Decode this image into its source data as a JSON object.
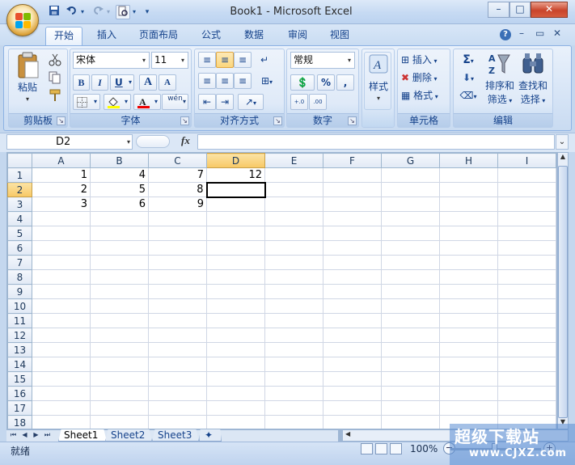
{
  "app": {
    "title": "Book1 - Microsoft Excel",
    "window_buttons": {
      "minimize": "–",
      "maximize": "□",
      "close": "✕"
    }
  },
  "qat": {
    "save_icon": "save-icon",
    "undo_icon": "undo-icon",
    "redo_icon": "redo-icon",
    "print_preview_icon": "print-preview-icon",
    "customize": "▾"
  },
  "ribbon_tabs": [
    {
      "label": "开始",
      "active": true
    },
    {
      "label": "插入"
    },
    {
      "label": "页面布局"
    },
    {
      "label": "公式"
    },
    {
      "label": "数据"
    },
    {
      "label": "审阅"
    },
    {
      "label": "视图"
    }
  ],
  "ribbon_right": {
    "help": "?",
    "minimize": "–",
    "restore": "▭",
    "close": "✕"
  },
  "groups": {
    "clipboard": {
      "label": "剪贴板",
      "paste": "粘贴"
    },
    "font": {
      "label": "字体",
      "font_name": "宋体",
      "font_size": "11",
      "bold": "B",
      "italic": "I",
      "underline": "U",
      "grow": "A",
      "shrink": "A",
      "phonetic": "wén"
    },
    "alignment": {
      "label": "对齐方式"
    },
    "number": {
      "label": "数字",
      "format": "常规",
      "percent": "%",
      "comma": ",",
      "inc_decimal": ".0→.00",
      "dec_decimal": ".00→.0"
    },
    "styles": {
      "label": "样式"
    },
    "cells": {
      "label": "单元格",
      "insert": "插入",
      "delete": "删除",
      "format": "格式"
    },
    "editing": {
      "label": "编辑",
      "sort_filter_1": "排序和",
      "sort_filter_2": "筛选",
      "find_select_1": "查找和",
      "find_select_2": "选择",
      "sum": "Σ"
    }
  },
  "formula_bar": {
    "name_box": "D2",
    "fx": "fx",
    "formula": ""
  },
  "columns": [
    "A",
    "B",
    "C",
    "D",
    "E",
    "F",
    "G",
    "H",
    "I"
  ],
  "selected_column": "D",
  "selected_row": 2,
  "active_cell": "D2",
  "rows": [
    {
      "n": "1",
      "cells": [
        "1",
        "4",
        "7",
        "12",
        "",
        "",
        "",
        "",
        ""
      ]
    },
    {
      "n": "2",
      "cells": [
        "2",
        "5",
        "8",
        "",
        "",
        "",
        "",
        "",
        ""
      ]
    },
    {
      "n": "3",
      "cells": [
        "3",
        "6",
        "9",
        "",
        "",
        "",
        "",
        "",
        ""
      ]
    },
    {
      "n": "4",
      "cells": [
        "",
        "",
        "",
        "",
        "",
        "",
        "",
        "",
        ""
      ]
    },
    {
      "n": "5",
      "cells": [
        "",
        "",
        "",
        "",
        "",
        "",
        "",
        "",
        ""
      ]
    },
    {
      "n": "6",
      "cells": [
        "",
        "",
        "",
        "",
        "",
        "",
        "",
        "",
        ""
      ]
    },
    {
      "n": "7",
      "cells": [
        "",
        "",
        "",
        "",
        "",
        "",
        "",
        "",
        ""
      ]
    },
    {
      "n": "8",
      "cells": [
        "",
        "",
        "",
        "",
        "",
        "",
        "",
        "",
        ""
      ]
    },
    {
      "n": "9",
      "cells": [
        "",
        "",
        "",
        "",
        "",
        "",
        "",
        "",
        ""
      ]
    },
    {
      "n": "10",
      "cells": [
        "",
        "",
        "",
        "",
        "",
        "",
        "",
        "",
        ""
      ]
    },
    {
      "n": "11",
      "cells": [
        "",
        "",
        "",
        "",
        "",
        "",
        "",
        "",
        ""
      ]
    },
    {
      "n": "12",
      "cells": [
        "",
        "",
        "",
        "",
        "",
        "",
        "",
        "",
        ""
      ]
    },
    {
      "n": "13",
      "cells": [
        "",
        "",
        "",
        "",
        "",
        "",
        "",
        "",
        ""
      ]
    },
    {
      "n": "14",
      "cells": [
        "",
        "",
        "",
        "",
        "",
        "",
        "",
        "",
        ""
      ]
    },
    {
      "n": "15",
      "cells": [
        "",
        "",
        "",
        "",
        "",
        "",
        "",
        "",
        ""
      ]
    },
    {
      "n": "16",
      "cells": [
        "",
        "",
        "",
        "",
        "",
        "",
        "",
        "",
        ""
      ]
    },
    {
      "n": "17",
      "cells": [
        "",
        "",
        "",
        "",
        "",
        "",
        "",
        "",
        ""
      ]
    },
    {
      "n": "18",
      "cells": [
        "",
        "",
        "",
        "",
        "",
        "",
        "",
        "",
        ""
      ]
    }
  ],
  "sheets": [
    {
      "label": "Sheet1",
      "active": true
    },
    {
      "label": "Sheet2"
    },
    {
      "label": "Sheet3"
    }
  ],
  "status": {
    "ready": "就绪",
    "zoom": "100%",
    "zoom_fraction": 0.5
  },
  "watermark": {
    "line1": "超级下载站",
    "line2": "www.CJXZ.com"
  },
  "colors": {
    "accent": "#15428b",
    "selection": "#f8c865",
    "ribbon": "#dfeaf8"
  }
}
